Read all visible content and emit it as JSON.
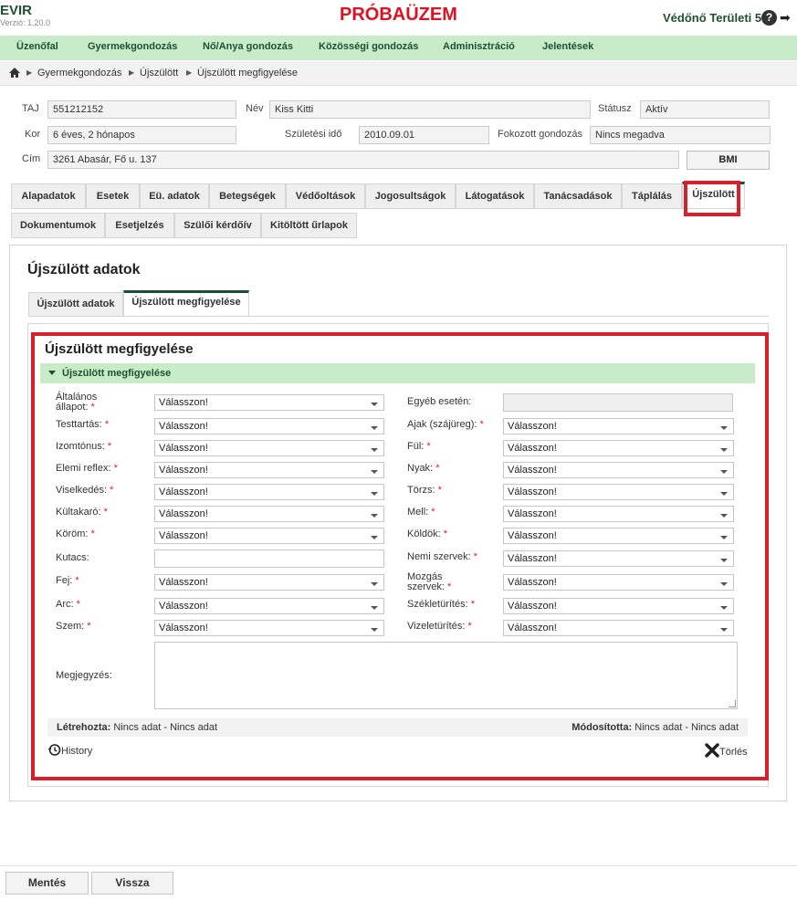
{
  "app": {
    "title": "EVIR",
    "version": "Verzió: 1.20.0",
    "banner": "PRÓBAÜZEM",
    "user": "Védőnő Területi 5",
    "help_symbol": "?",
    "logout_symbol": "➡"
  },
  "mainnav": [
    {
      "label": "Üzenőfal"
    },
    {
      "label": "Gyermekgondozás"
    },
    {
      "label": "Nő/Anya gondozás"
    },
    {
      "label": "Közösségi gondozás"
    },
    {
      "label": "Adminisztráció"
    },
    {
      "label": "Jelentések"
    }
  ],
  "breadcrumb": [
    "Gyermekgondozás",
    "Újszülött",
    "Újszülött megfigyelése"
  ],
  "patient": {
    "taj_label": "TAJ",
    "taj": "551212152",
    "nev_label": "Név",
    "nev": "Kiss Kitti",
    "statusz_label": "Státusz",
    "statusz": "Aktív",
    "kor_label": "Kor",
    "kor": "6 éves, 2 hónapos",
    "szul_label": "Születési idő",
    "szul": "2010.09.01",
    "fokozott_label": "Fokozott gondozás",
    "fokozott": "Nincs megadva",
    "cim_label": "Cím",
    "cim": "3261 Abasár, Fő u. 137",
    "bmi_label": "BMI"
  },
  "tabs": [
    {
      "label": "Alapadatok"
    },
    {
      "label": "Esetek"
    },
    {
      "label": "Eü. adatok"
    },
    {
      "label": "Betegségek"
    },
    {
      "label": "Védőoltások"
    },
    {
      "label": "Jogosultságok"
    },
    {
      "label": "Látogatások"
    },
    {
      "label": "Tanácsadások"
    },
    {
      "label": "Táplálás"
    },
    {
      "label": "Újszülött"
    },
    {
      "label": "Dokumentumok"
    },
    {
      "label": "Esetjelzés"
    },
    {
      "label": "Szülői kérdőív"
    },
    {
      "label": "Kitöltött űrlapok"
    }
  ],
  "section": {
    "title": "Újszülött adatok",
    "subtabs": [
      {
        "label": "Újszülött adatok"
      },
      {
        "label": "Újszülött megfigyelése"
      }
    ]
  },
  "form": {
    "title": "Újszülött megfigyelése",
    "group_label": "Újszülött megfigyelése",
    "placeholder": "Válasszon!",
    "required_mark": "*",
    "left": [
      {
        "label": "Általános állapot:",
        "line1": "Általános",
        "line2": "állapot:",
        "required": true
      },
      {
        "label": "Testtartás:",
        "required": true
      },
      {
        "label": "Izomtónus:",
        "required": true
      },
      {
        "label": "Elemi reflex:",
        "required": true
      },
      {
        "label": "Viselkedés:",
        "required": true
      },
      {
        "label": "Kültakaró:",
        "required": true
      },
      {
        "label": "Köröm:",
        "required": true
      },
      {
        "label": "Kutacs:",
        "required": false
      },
      {
        "label": "Fej:",
        "required": true
      },
      {
        "label": "Arc:",
        "required": true
      },
      {
        "label": "Szem:",
        "required": true
      }
    ],
    "right": [
      {
        "label": "Egyéb esetén:",
        "required": false
      },
      {
        "label": "Ajak (szájüreg):",
        "required": true
      },
      {
        "label": "Fül:",
        "required": true
      },
      {
        "label": "Nyak:",
        "required": true
      },
      {
        "label": "Törzs:",
        "required": true
      },
      {
        "label": "Mell:",
        "required": true
      },
      {
        "label": "Köldök:",
        "required": true
      },
      {
        "label": "Nemi szervek:",
        "required": true
      },
      {
        "label": "Mozgás szervek:",
        "line1": "Mozgás",
        "line2": "szervek:",
        "required": true
      },
      {
        "label": "Székletürítés:",
        "required": true
      },
      {
        "label": "Vizeletürítés:",
        "required": true
      }
    ],
    "megjegyzes_label": "Megjegyzés:",
    "created_label": "Létrehozta:",
    "created_value": "Nincs adat - Nincs adat",
    "modified_label": "Módosította:",
    "modified_value": "Nincs adat - Nincs adat",
    "history_label": "History",
    "delete_label": "Törlés"
  },
  "footer": {
    "save_label": "Mentés",
    "back_label": "Vissza"
  },
  "colors": {
    "accent": "#1f4f31",
    "nav_bg": "#c8ecc8",
    "highlight": "#d81f2a",
    "banner": "#dd1122"
  }
}
